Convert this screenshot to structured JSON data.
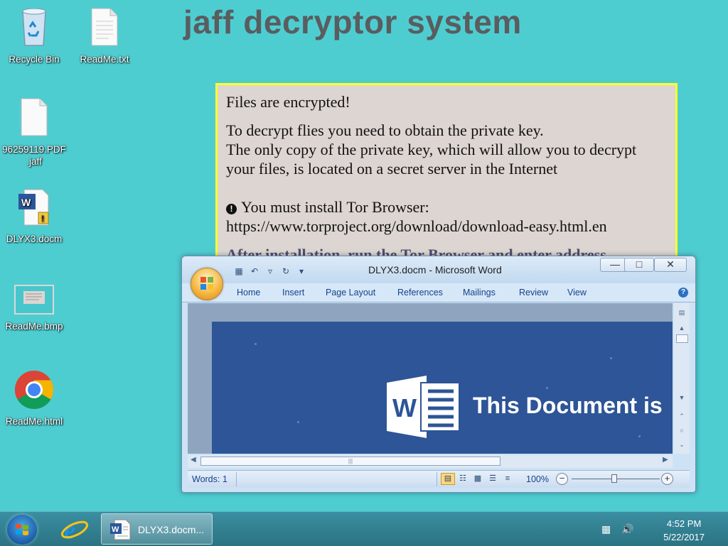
{
  "wallpaper": {
    "title": "jaff decryptor system"
  },
  "note": {
    "line1": "Files are encrypted!",
    "line2": "To decrypt flies you need to obtain the private key.",
    "line3": "The only copy of the private key, which will allow you to decrypt",
    "line4": "your files, is located on a secret server in the Internet",
    "line5": "You must install Tor Browser:",
    "line6": "https://www.torproject.org/download/download-easy.html.en",
    "line7_partial": "After installation, run the Tor Browser and enter address"
  },
  "desktop_icons": [
    {
      "label": "Recycle Bin",
      "icon": "recycle-bin-icon"
    },
    {
      "label": "ReadMe.txt",
      "icon": "text-file-icon"
    },
    {
      "label": "96259119.PDF\n.jaff",
      "label_l1": "96259119.PDF",
      "label_l2": ".jaff",
      "icon": "blank-file-icon"
    },
    {
      "label": "DLYX3.docm",
      "icon": "word-macro-doc-icon"
    },
    {
      "label": "ReadMe.bmp",
      "icon": "bitmap-file-icon"
    },
    {
      "label": "ReadMe.html",
      "icon": "chrome-icon"
    }
  ],
  "word_window": {
    "title": "DLYX3.docm - Microsoft Word",
    "tabs": [
      "Home",
      "Insert",
      "Page Layout",
      "References",
      "Mailings",
      "Review",
      "View"
    ],
    "document_text": "This Document is",
    "status": {
      "words": "Words: 1",
      "zoom": "100%"
    },
    "zoom_level_percent": 100
  },
  "taskbar": {
    "task_label": "DLYX3.docm...",
    "clock_time": "4:52 PM",
    "clock_date": "5/22/2017"
  },
  "colors": {
    "desktop": "#4ecdd1",
    "note_bg": "#ddd5d1",
    "note_border": "#ffff2a",
    "word_blue": "#2d5597"
  }
}
